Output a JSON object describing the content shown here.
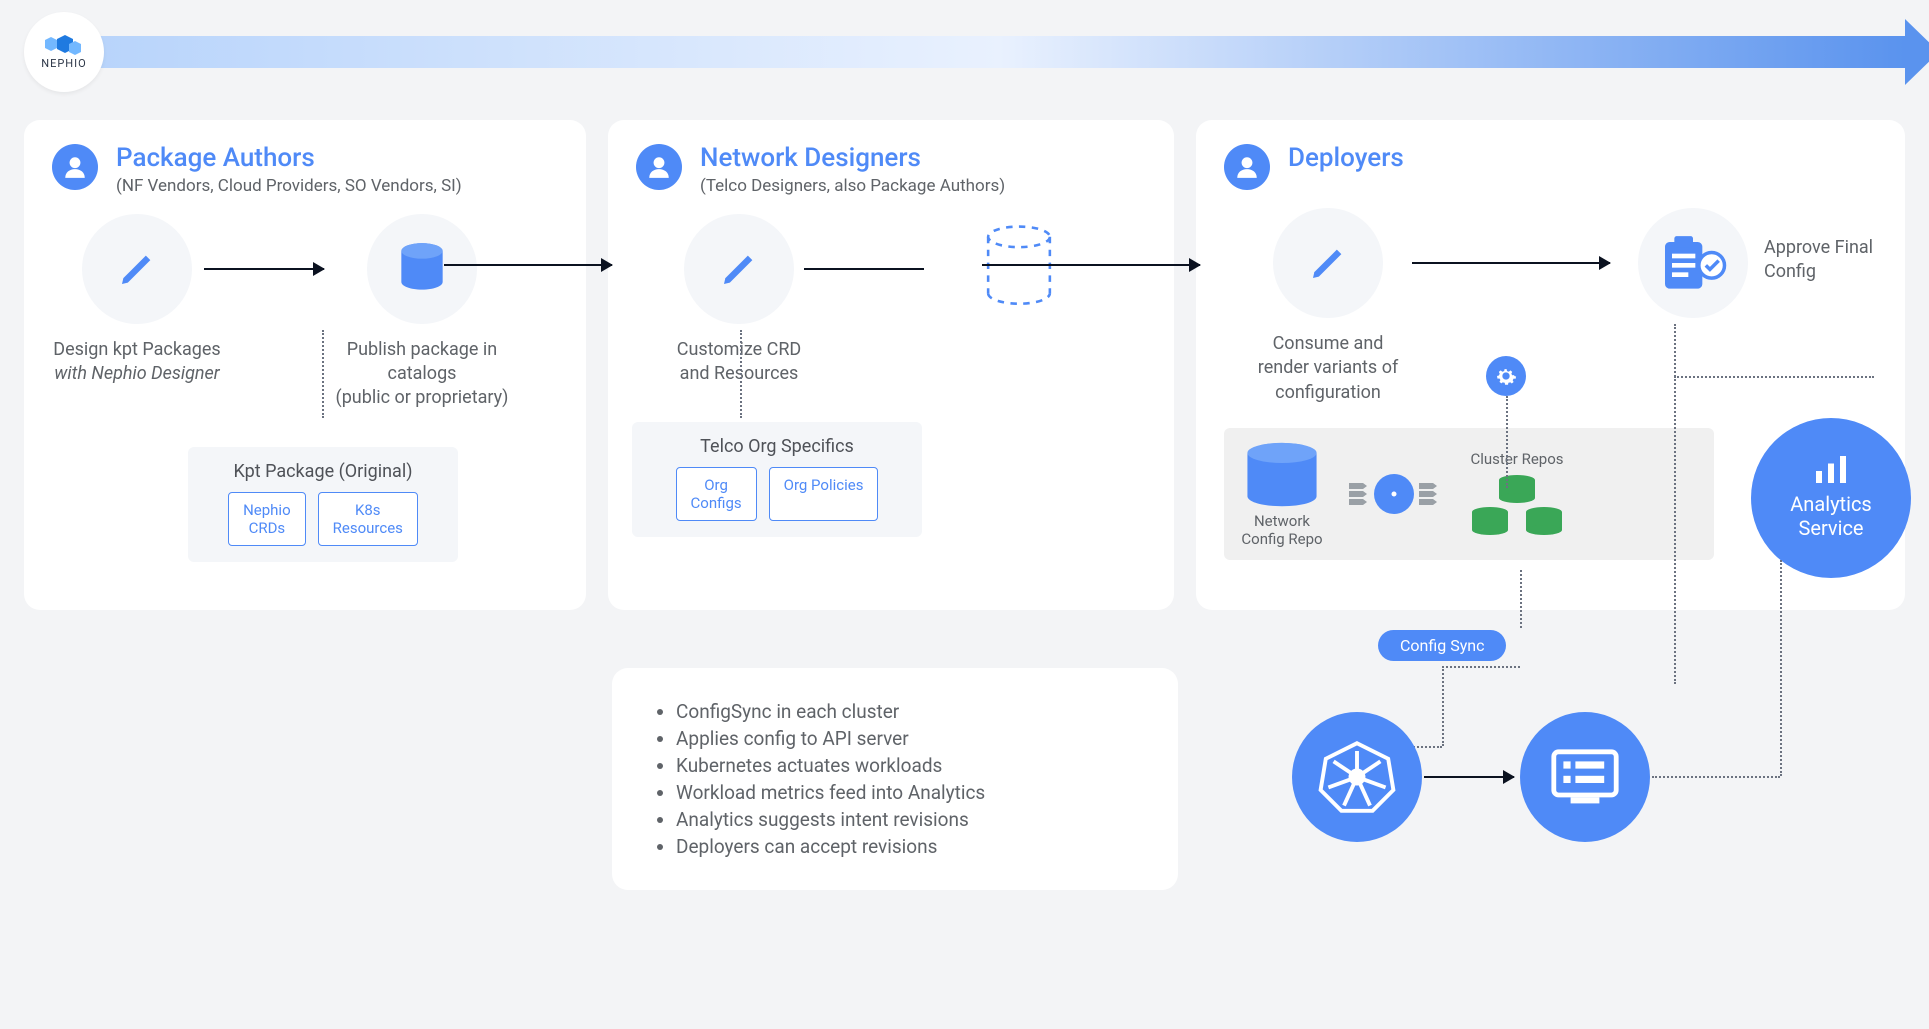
{
  "brand": "NEPHIO",
  "columns": {
    "authors": {
      "title": "Package Authors",
      "subtitle": "(NF Vendors, Cloud Providers, SO Vendors, SI)",
      "node1_caption_line1": "Design kpt Packages",
      "node1_caption_em": "with Nephio Designer",
      "node2_caption": "Publish package in catalogs\n(public or proprietary)",
      "pkg_box_title": "Kpt Package (Original)",
      "chip1": "Nephio\nCRDs",
      "chip2": "K8s\nResources"
    },
    "designers": {
      "title": "Network Designers",
      "subtitle": "(Telco Designers, also Package Authors)",
      "node1_caption": "Customize CRD\nand Resources",
      "pkg_box_title": "Telco Org Specifics",
      "chip1": "Org\nConfigs",
      "chip2": "Org Policies"
    },
    "deployers": {
      "title": "Deployers",
      "node1_caption": "Consume and\nrender variants of\nconfiguration",
      "node2_caption": "Approve Final\nConfig",
      "repo_label": "Network\nConfig Repo",
      "cluster_repos_label": "Cluster Repos",
      "analytics_label": "Analytics\nService",
      "config_sync_label": "Config Sync"
    }
  },
  "notes": [
    "ConfigSync in each cluster",
    "Applies config to API server",
    "Kubernetes actuates workloads",
    "Workload metrics feed into Analytics",
    "Analytics suggests intent revisions",
    "Deployers can accept revisions"
  ]
}
